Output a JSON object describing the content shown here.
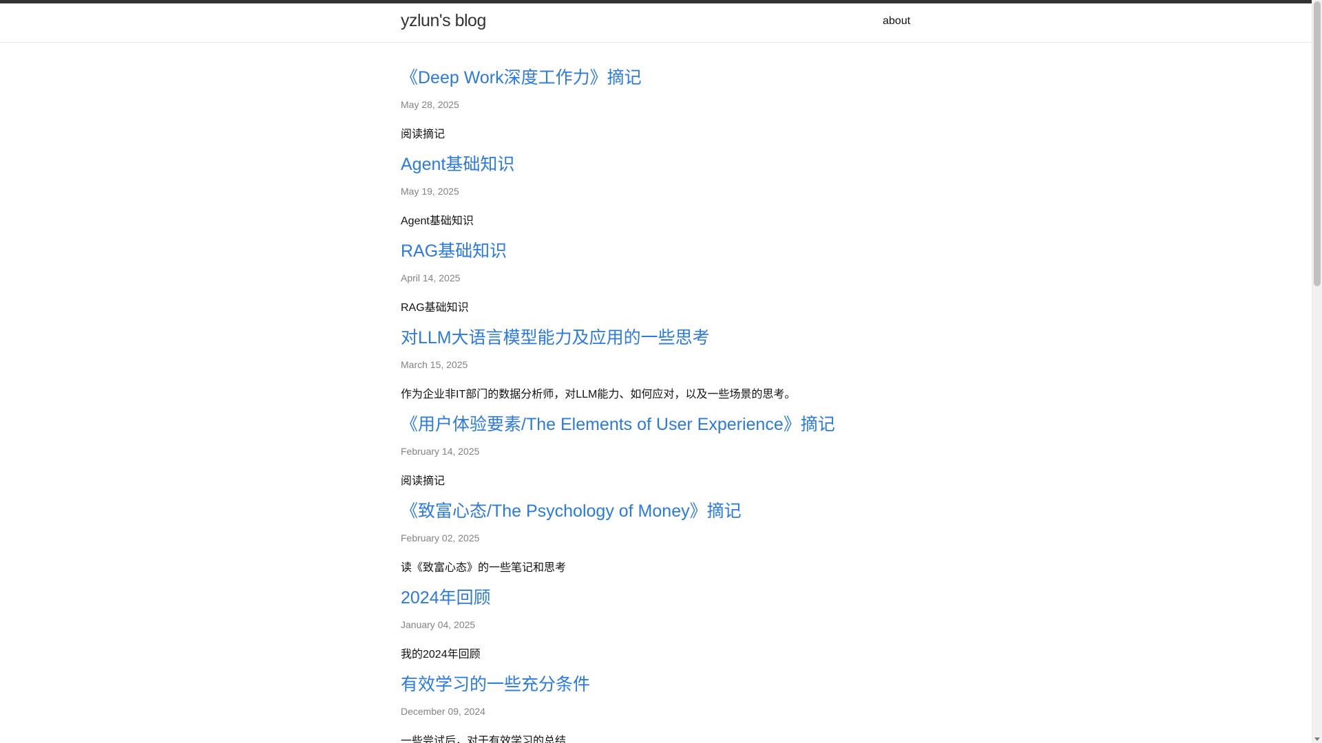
{
  "header": {
    "site_title": "yzlun's blog",
    "nav": [
      {
        "label": "about"
      }
    ]
  },
  "posts": [
    {
      "title": "《Deep Work深度工作力》摘记",
      "date": "May 28, 2025",
      "excerpt": "阅读摘记"
    },
    {
      "title": "Agent基础知识",
      "date": "May 19, 2025",
      "excerpt": "Agent基础知识"
    },
    {
      "title": "RAG基础知识",
      "date": "April 14, 2025",
      "excerpt": "RAG基础知识"
    },
    {
      "title": "对LLM大语言模型能力及应用的一些思考",
      "date": "March 15, 2025",
      "excerpt": "作为企业非IT部门的数据分析师，对LLM能力、如何应对，以及一些场景的思考。"
    },
    {
      "title": "《用户体验要素/The Elements of User Experience》摘记",
      "date": "February 14, 2025",
      "excerpt": "阅读摘记"
    },
    {
      "title": "《致富心态/The Psychology of Money》摘记",
      "date": "February 02, 2025",
      "excerpt": "读《致富心态》的一些笔记和思考"
    },
    {
      "title": "2024年回顾",
      "date": "January 04, 2025",
      "excerpt": "我的2024年回顾"
    },
    {
      "title": "有效学习的一些充分条件",
      "date": "December 09, 2024",
      "excerpt": "一些尝试后，对于有效学习的总结"
    }
  ],
  "colors": {
    "link": "#2a7ae2",
    "date": "#828282",
    "text": "#111111",
    "top_strip": "#333333"
  }
}
